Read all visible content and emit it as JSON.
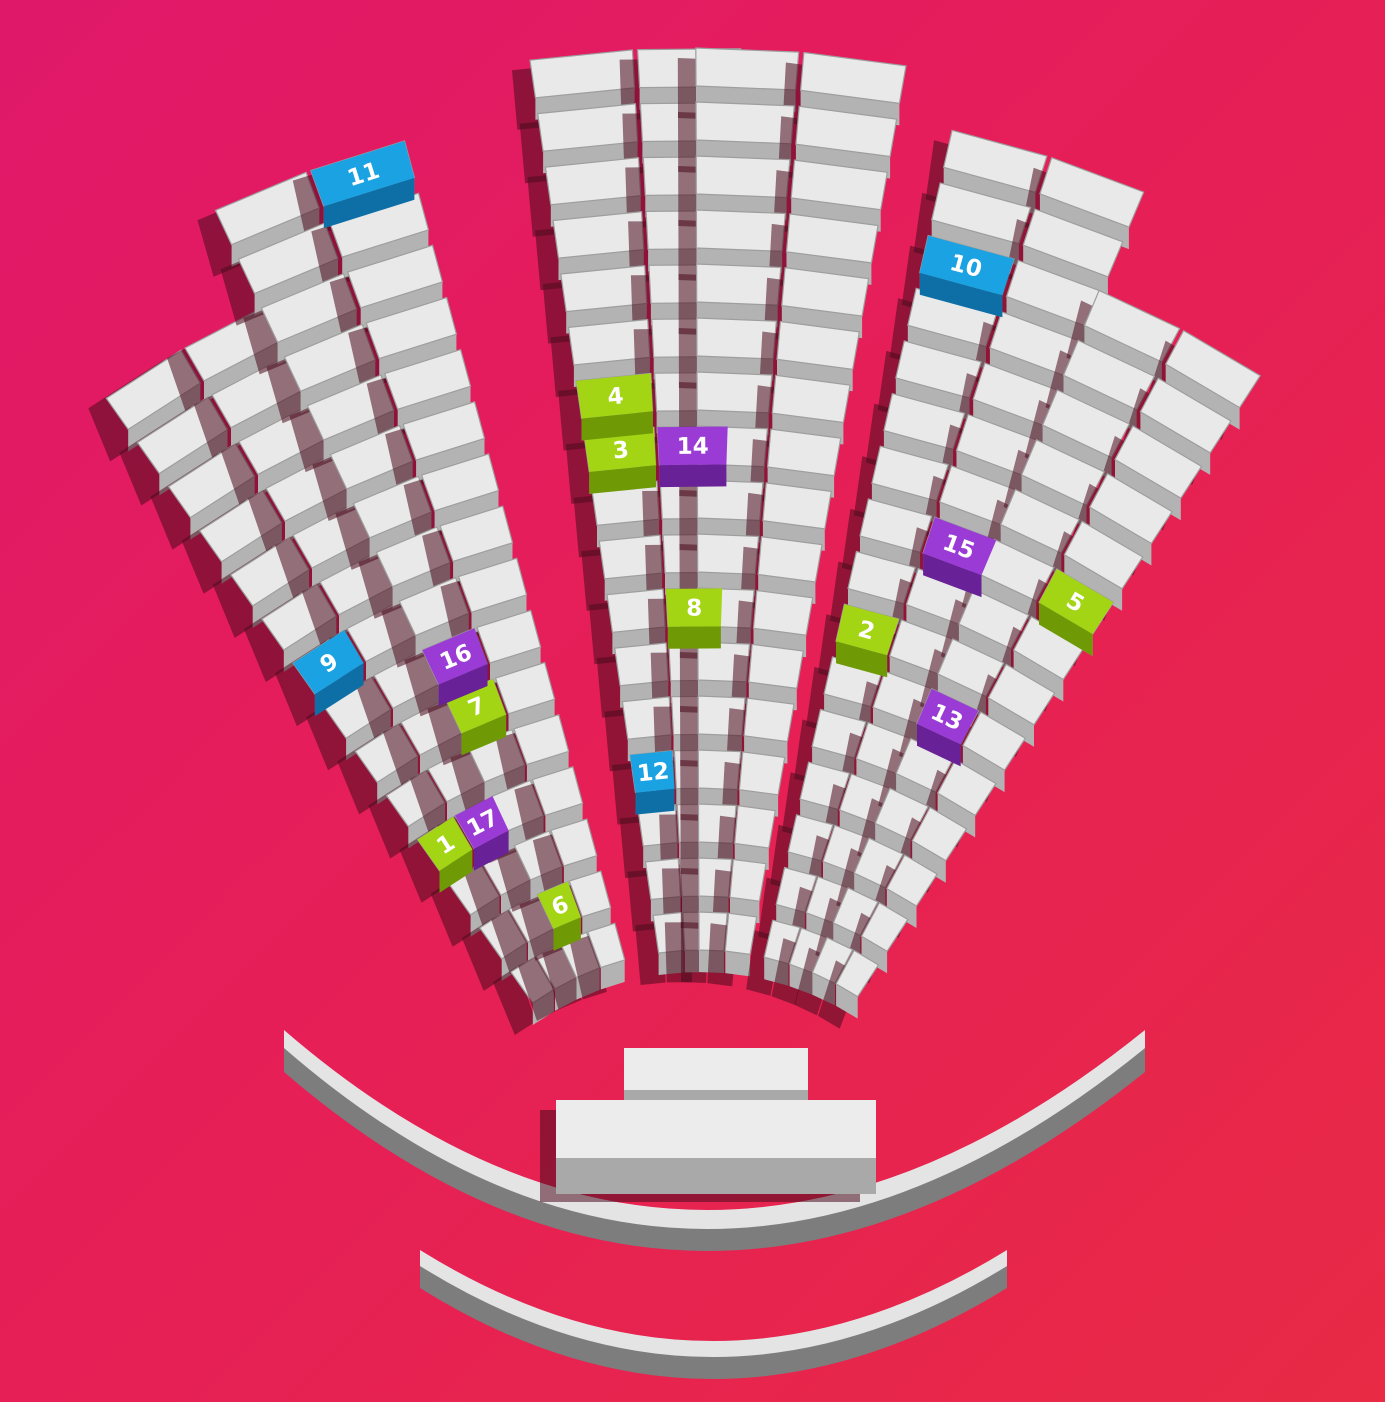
{
  "colors": {
    "background_from": "#e0186a",
    "background_to": "#e82a45",
    "seat_top": "#e9e9e9",
    "seat_front": "#b3b3b3",
    "shadow": "#4a0b1e",
    "green": "#a3d515",
    "green_dark": "#6f9a05",
    "blue": "#1aa2e3",
    "blue_dark": "#0d6fa6",
    "purple": "#9b3bd6",
    "purple_dark": "#682197"
  },
  "sections": [
    {
      "name": "section-left-outer",
      "angle": -30,
      "rows": 14,
      "seats": 2,
      "row_offset": 0
    },
    {
      "name": "section-left-inner",
      "angle": -20,
      "rows": 16,
      "seats": 2,
      "row_offset": 0
    },
    {
      "name": "section-center-left",
      "angle": -3,
      "rows": 17,
      "seats": 2,
      "row_offset": 0
    },
    {
      "name": "section-center-right",
      "angle": 5,
      "rows": 17,
      "seats": 2,
      "row_offset": 0
    },
    {
      "name": "section-right-inner",
      "angle": 18,
      "rows": 16,
      "seats": 2,
      "row_offset": 0
    },
    {
      "name": "section-right-outer",
      "angle": 28,
      "rows": 14,
      "seats": 2,
      "row_offset": 0
    }
  ],
  "marked_seats": [
    {
      "label": "1",
      "color": "green",
      "section": 0,
      "row": 3,
      "seat": 0
    },
    {
      "label": "17",
      "color": "purple",
      "section": 0,
      "row": 3,
      "seat": 1
    },
    {
      "label": "9",
      "color": "blue",
      "section": 0,
      "row": 7,
      "seat": 0
    },
    {
      "label": "6",
      "color": "green",
      "section": 1,
      "row": 1,
      "seat": 0
    },
    {
      "label": "7",
      "color": "green",
      "section": 1,
      "row": 5,
      "seat": 0
    },
    {
      "label": "16",
      "color": "purple",
      "section": 1,
      "row": 6,
      "seat": 0
    },
    {
      "label": "11",
      "color": "blue",
      "section": 1,
      "row": 15,
      "seat": 1
    },
    {
      "label": "12",
      "color": "blue",
      "section": 2,
      "row": 3,
      "seat": 0
    },
    {
      "label": "8",
      "color": "green",
      "section": 2,
      "row": 6,
      "seat": 1
    },
    {
      "label": "3",
      "color": "green",
      "section": 2,
      "row": 9,
      "seat": 0
    },
    {
      "label": "14",
      "color": "purple",
      "section": 2,
      "row": 9,
      "seat": 1
    },
    {
      "label": "4",
      "color": "green",
      "section": 2,
      "row": 10,
      "seat": 0
    },
    {
      "label": "2",
      "color": "green",
      "section": 4,
      "row": 6,
      "seat": 0
    },
    {
      "label": "15",
      "color": "purple",
      "section": 4,
      "row": 8,
      "seat": 1
    },
    {
      "label": "10",
      "color": "blue",
      "section": 4,
      "row": 13,
      "seat": 0
    },
    {
      "label": "13",
      "color": "purple",
      "section": 5,
      "row": 5,
      "seat": 0
    },
    {
      "label": "5",
      "color": "green",
      "section": 5,
      "row": 8,
      "seat": 1
    }
  ]
}
